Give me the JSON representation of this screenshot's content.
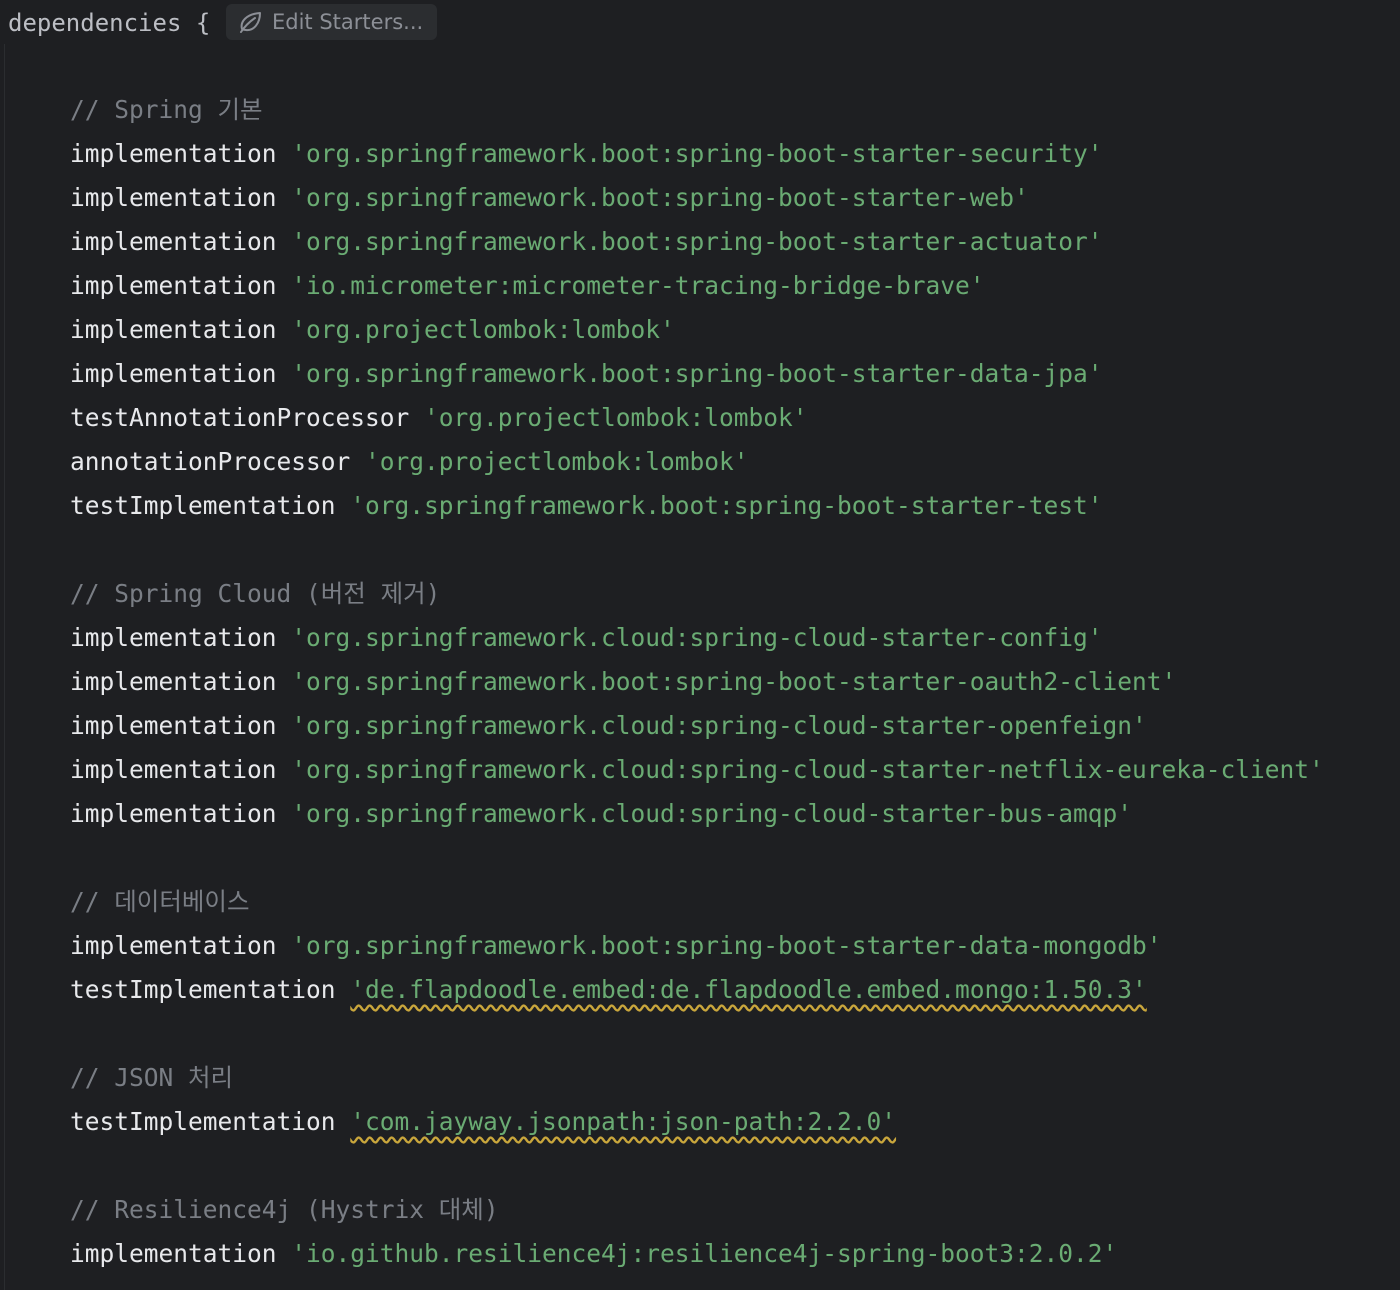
{
  "header": {
    "keyword": "dependencies",
    "brace": "{",
    "starters_button_label": "Edit Starters...",
    "starters_icon": "spring-leaf-icon"
  },
  "colors": {
    "background": "#1e1f22",
    "comment": "#7a7e85",
    "method": "#e8e9ec",
    "string": "#6aab73",
    "warning_underline": "#c9a63c"
  },
  "lines": [
    {
      "kind": "comment",
      "text": "// Spring 기본"
    },
    {
      "kind": "dep",
      "method": "implementation",
      "value": "'org.springframework.boot:spring-boot-starter-security'"
    },
    {
      "kind": "dep",
      "method": "implementation",
      "value": "'org.springframework.boot:spring-boot-starter-web'"
    },
    {
      "kind": "dep",
      "method": "implementation",
      "value": "'org.springframework.boot:spring-boot-starter-actuator'"
    },
    {
      "kind": "dep",
      "method": "implementation",
      "value": "'io.micrometer:micrometer-tracing-bridge-brave'"
    },
    {
      "kind": "dep",
      "method": "implementation",
      "value": "'org.projectlombok:lombok'"
    },
    {
      "kind": "dep",
      "method": "implementation",
      "value": "'org.springframework.boot:spring-boot-starter-data-jpa'"
    },
    {
      "kind": "dep",
      "method": "testAnnotationProcessor",
      "value": "'org.projectlombok:lombok'"
    },
    {
      "kind": "dep",
      "method": "annotationProcessor",
      "value": "'org.projectlombok:lombok'"
    },
    {
      "kind": "dep",
      "method": "testImplementation",
      "value": "'org.springframework.boot:spring-boot-starter-test'"
    },
    {
      "kind": "blank"
    },
    {
      "kind": "comment",
      "text": "// Spring Cloud (버전 제거)"
    },
    {
      "kind": "dep",
      "method": "implementation",
      "value": "'org.springframework.cloud:spring-cloud-starter-config'"
    },
    {
      "kind": "dep",
      "method": "implementation",
      "value": "'org.springframework.boot:spring-boot-starter-oauth2-client'"
    },
    {
      "kind": "dep",
      "method": "implementation",
      "value": "'org.springframework.cloud:spring-cloud-starter-openfeign'"
    },
    {
      "kind": "dep",
      "method": "implementation",
      "value": "'org.springframework.cloud:spring-cloud-starter-netflix-eureka-client'"
    },
    {
      "kind": "dep",
      "method": "implementation",
      "value": "'org.springframework.cloud:spring-cloud-starter-bus-amqp'"
    },
    {
      "kind": "blank"
    },
    {
      "kind": "comment",
      "text": "// 데이터베이스"
    },
    {
      "kind": "dep",
      "method": "implementation",
      "value": "'org.springframework.boot:spring-boot-starter-data-mongodb'"
    },
    {
      "kind": "dep",
      "method": "testImplementation",
      "value": "'de.flapdoodle.embed:de.flapdoodle.embed.mongo:1.50.3'",
      "warning": true
    },
    {
      "kind": "blank"
    },
    {
      "kind": "comment",
      "text": "// JSON 처리"
    },
    {
      "kind": "dep",
      "method": "testImplementation",
      "value": "'com.jayway.jsonpath:json-path:2.2.0'",
      "warning": true
    },
    {
      "kind": "blank"
    },
    {
      "kind": "comment",
      "text": "// Resilience4j (Hystrix 대체)"
    },
    {
      "kind": "dep",
      "method": "implementation",
      "value": "'io.github.resilience4j:resilience4j-spring-boot3:2.0.2'"
    }
  ]
}
